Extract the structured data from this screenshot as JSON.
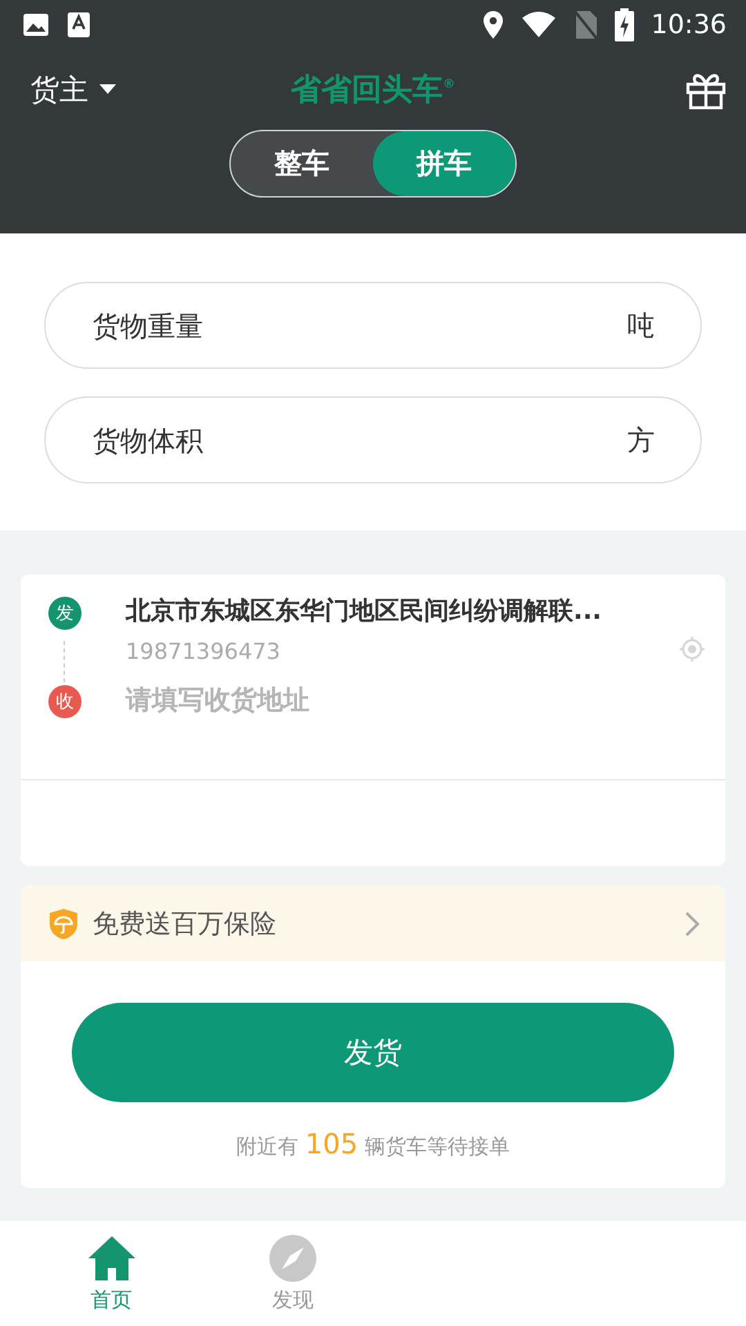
{
  "status_bar": {
    "time": "10:36"
  },
  "header": {
    "role": "货主",
    "logo": "省省回头车$^{®}$"
  },
  "mode_tabs": [
    {
      "label": "整车",
      "selected": false
    },
    {
      "label": "拼车",
      "selected": true
    }
  ],
  "cargo_fields": [
    {
      "placeholder": "货物重量",
      "unit": "吨"
    },
    {
      "placeholder": "货物体积",
      "unit": "方"
    }
  ],
  "route": [
    {
      "badge": "发",
      "color": "#14946f",
      "address": "北京市东城区东华门地区民间纠纷调解联...",
      "phone": "19871396473"
    },
    {
      "badge": "收",
      "color": "#e85a4f",
      "placeholder": "请填写收货地址"
    }
  ],
  "insurance": {
    "label": "免费送百万保险"
  },
  "ship_button": "发货",
  "nearby": {
    "before": "附近有",
    "count": "105",
    "after": "辆货车等待接单"
  },
  "bottom_tabs": [
    {
      "label": "首页",
      "selected": true
    },
    {
      "label": "发现",
      "selected": false
    }
  ]
}
